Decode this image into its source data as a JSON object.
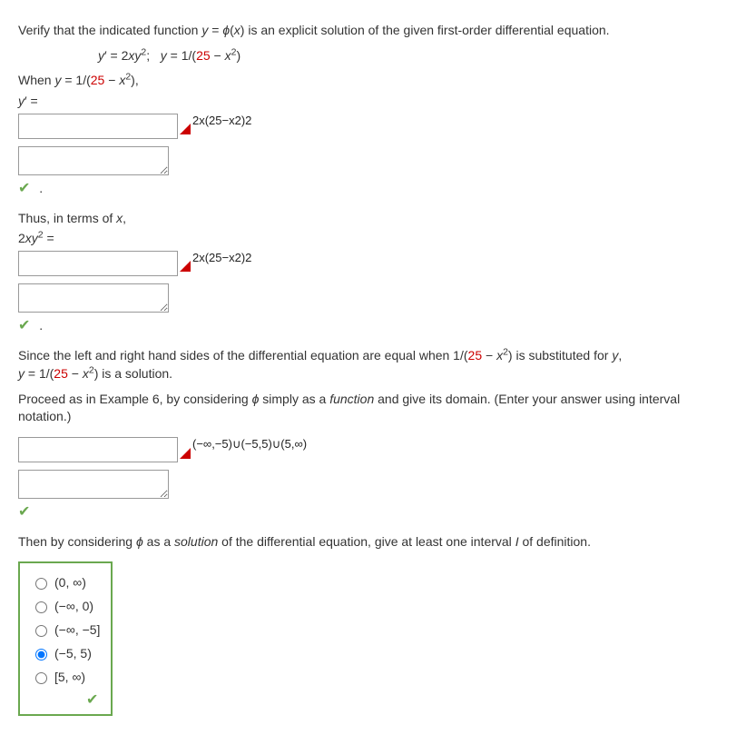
{
  "intro": "Verify that the indicated function y = ϕ(x) is an explicit solution of the given first-order differential equation.",
  "equation": "y′ = 2xy²;   y = 1/(25 − x²)",
  "when_line": "When y = 1/(25 − x²),",
  "yprime_label": "y′ =",
  "hint1": "2x(25−x2)2",
  "thus_line": "Thus, in terms of x,",
  "two_xy2_label": "2xy² =",
  "hint2": "2x(25−x2)2",
  "since_line": "Since the left and right hand sides of the differential equation are equal when 1/(25 − x²) is substituted for y, y = 1/(25 − x²) is a solution.",
  "proceed_line": "Proceed as in Example 6, by considering ϕ simply as a function and give its domain. (Enter your answer using interval notation.)",
  "hint3": "(−∞,−5)∪(−5,5)∪(5,∞)",
  "then_line": "Then by considering ϕ as a solution of the differential equation, give at least one interval I of definition.",
  "options": {
    "o1": "(0, ∞)",
    "o2": "(−∞, 0)",
    "o3": "(−∞, −5]",
    "o4": "(−5, 5)",
    "o5": "[5, ∞)"
  }
}
